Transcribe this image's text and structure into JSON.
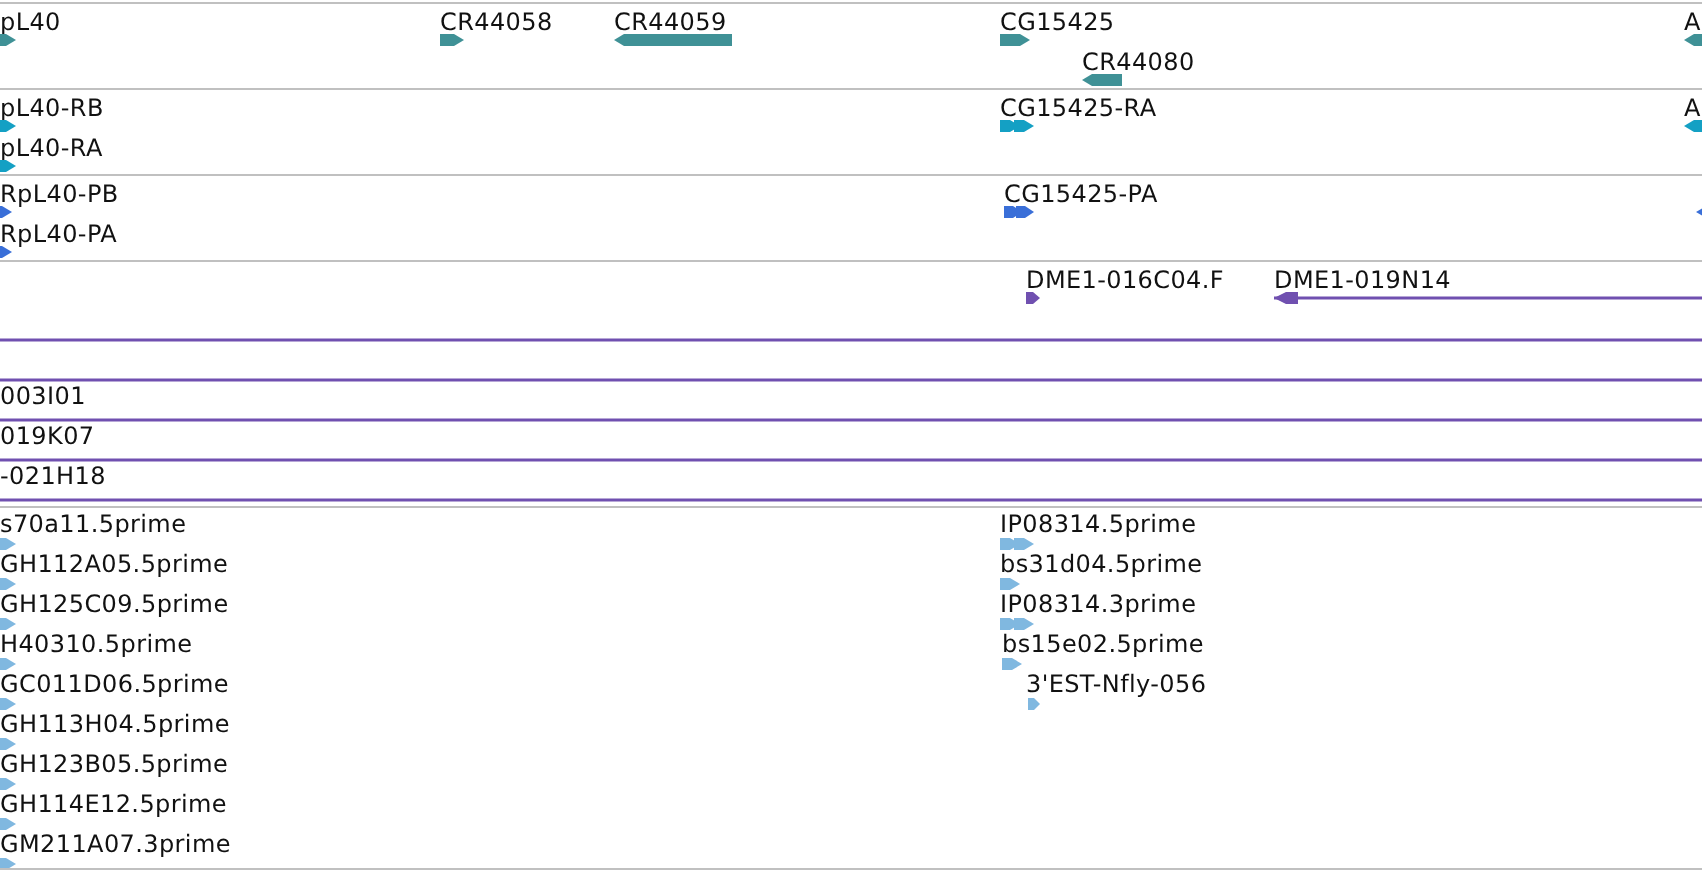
{
  "tracks": [
    {
      "color": "#3f9196",
      "features": [
        {
          "label": "pL40",
          "reverse": false,
          "kind": "block"
        },
        {
          "label": "CR44058",
          "reverse": false,
          "kind": "block"
        },
        {
          "label": "CR44059",
          "reverse": true,
          "kind": "block"
        },
        {
          "label": "CG15425",
          "reverse": false,
          "kind": "block"
        },
        {
          "label": "CR44080",
          "reverse": true,
          "kind": "block"
        },
        {
          "label": "A",
          "reverse": true,
          "kind": "block"
        }
      ]
    },
    {
      "color": "#14a0c4",
      "features": [
        {
          "label": "pL40-RB",
          "reverse": false,
          "kind": "block"
        },
        {
          "label": "pL40-RA",
          "reverse": false,
          "kind": "block"
        },
        {
          "label": "CG15425-RA",
          "reverse": false,
          "kind": "segmented"
        },
        {
          "label": "A",
          "reverse": true,
          "kind": "block"
        }
      ]
    },
    {
      "color": "#3a6fd8",
      "features": [
        {
          "label": "RpL40-PB",
          "reverse": false,
          "kind": "block"
        },
        {
          "label": "RpL40-PA",
          "reverse": false,
          "kind": "block"
        },
        {
          "label": "CG15425-PA",
          "reverse": false,
          "kind": "segmented"
        },
        {
          "reverse": true,
          "kind": "block"
        }
      ]
    },
    {
      "color": "#7050b0",
      "features": [
        {
          "label": "DME1-016C04.F",
          "reverse": false,
          "kind": "block"
        },
        {
          "label": "DME1-019N14",
          "reverse": true,
          "kind": "line"
        },
        {
          "kind": "line"
        },
        {
          "kind": "line"
        },
        {
          "label": "003I01",
          "kind": "line"
        },
        {
          "label": "019K07",
          "kind": "line"
        },
        {
          "label": "-021H18",
          "kind": "line"
        }
      ]
    },
    {
      "color": "#80b8e0",
      "features": [
        {
          "label": "s70a11.5prime",
          "reverse": false,
          "kind": "block"
        },
        {
          "label": "GH112A05.5prime",
          "reverse": false,
          "kind": "block"
        },
        {
          "label": "GH125C09.5prime",
          "reverse": false,
          "kind": "block"
        },
        {
          "label": "H40310.5prime",
          "reverse": false,
          "kind": "block"
        },
        {
          "label": "GC011D06.5prime",
          "reverse": false,
          "kind": "block"
        },
        {
          "label": "GH113H04.5prime",
          "reverse": false,
          "kind": "block"
        },
        {
          "label": "GH123B05.5prime",
          "reverse": false,
          "kind": "block"
        },
        {
          "label": "GH114E12.5prime",
          "reverse": false,
          "kind": "block"
        },
        {
          "label": "GM211A07.3prime",
          "reverse": false,
          "kind": "block"
        },
        {
          "label": "IP08314.5prime",
          "reverse": false,
          "kind": "segmented"
        },
        {
          "label": "bs31d04.5prime",
          "reverse": false,
          "kind": "block"
        },
        {
          "label": "IP08314.3prime",
          "reverse": false,
          "kind": "segmented"
        },
        {
          "label": "bs15e02.5prime",
          "reverse": false,
          "kind": "block"
        },
        {
          "label": "3'EST-Nfly-056",
          "reverse": false,
          "kind": "block"
        }
      ]
    }
  ]
}
